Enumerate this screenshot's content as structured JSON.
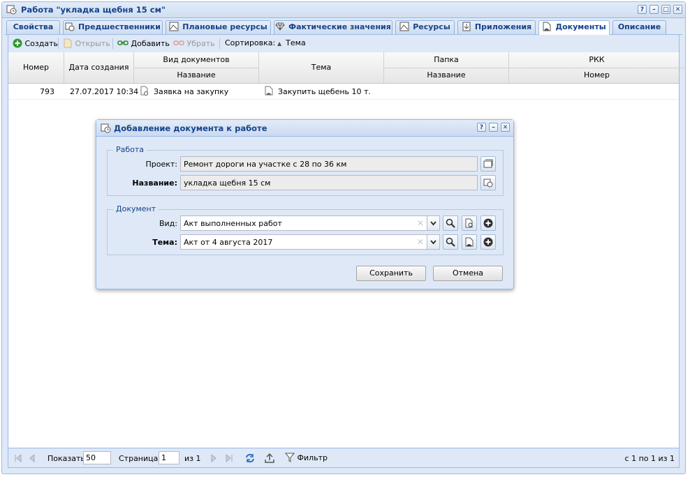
{
  "window": {
    "title": "Работа \"укладка щебня 15 см\"",
    "tools": [
      "?",
      "–",
      "□",
      "✕"
    ]
  },
  "tabs": [
    {
      "label": "Свойства"
    },
    {
      "label": "Предшественники"
    },
    {
      "label": "Плановые ресурсы"
    },
    {
      "label": "Фактические значения"
    },
    {
      "label": "Ресурсы"
    },
    {
      "label": "Приложения"
    },
    {
      "label": "Документы"
    },
    {
      "label": "Описание"
    }
  ],
  "active_tab": "Документы",
  "toolbar": {
    "create_label": "Создать",
    "open_label": "Открыть",
    "add_label": "Добавить",
    "remove_label": "Убрать",
    "sort_label": "Сортировка:",
    "sort_field": "Тема"
  },
  "grid": {
    "headers": {
      "number": "Номер",
      "created": "Дата создания",
      "doc_type_group": "Вид документов",
      "doc_type_name": "Название",
      "subject": "Тема",
      "folder_group": "Папка",
      "folder_name": "Название",
      "pkk_group": "РКК",
      "pkk_number": "Номер"
    },
    "rows": [
      {
        "number": "793",
        "created": "27.07.2017 10:34",
        "doc_type": "Заявка на закупку",
        "subject": "Закупить щебень 10 т.",
        "folder": "",
        "pkk": ""
      }
    ]
  },
  "pager": {
    "show_label": "Показать",
    "page_size": "50",
    "page_label": "Страница",
    "page": "1",
    "of_label": "из 1",
    "filter_label": "Фильтр",
    "summary": "с 1 по 1 из 1"
  },
  "dialog": {
    "title": "Добавление документа к работе",
    "tools": [
      "?",
      "–",
      "✕"
    ],
    "work_section": {
      "legend": "Работа",
      "project_label": "Проект:",
      "project_value": "Ремонт дороги на участке с 28 по 36 км",
      "name_label": "Название:",
      "name_value": "укладка щебня 15 см"
    },
    "doc_section": {
      "legend": "Документ",
      "type_label": "Вид:",
      "type_value": "Акт выполненных работ",
      "subject_label": "Тема:",
      "subject_value": "Акт от 4 августа 2017"
    },
    "save_label": "Сохранить",
    "cancel_label": "Отмена"
  }
}
